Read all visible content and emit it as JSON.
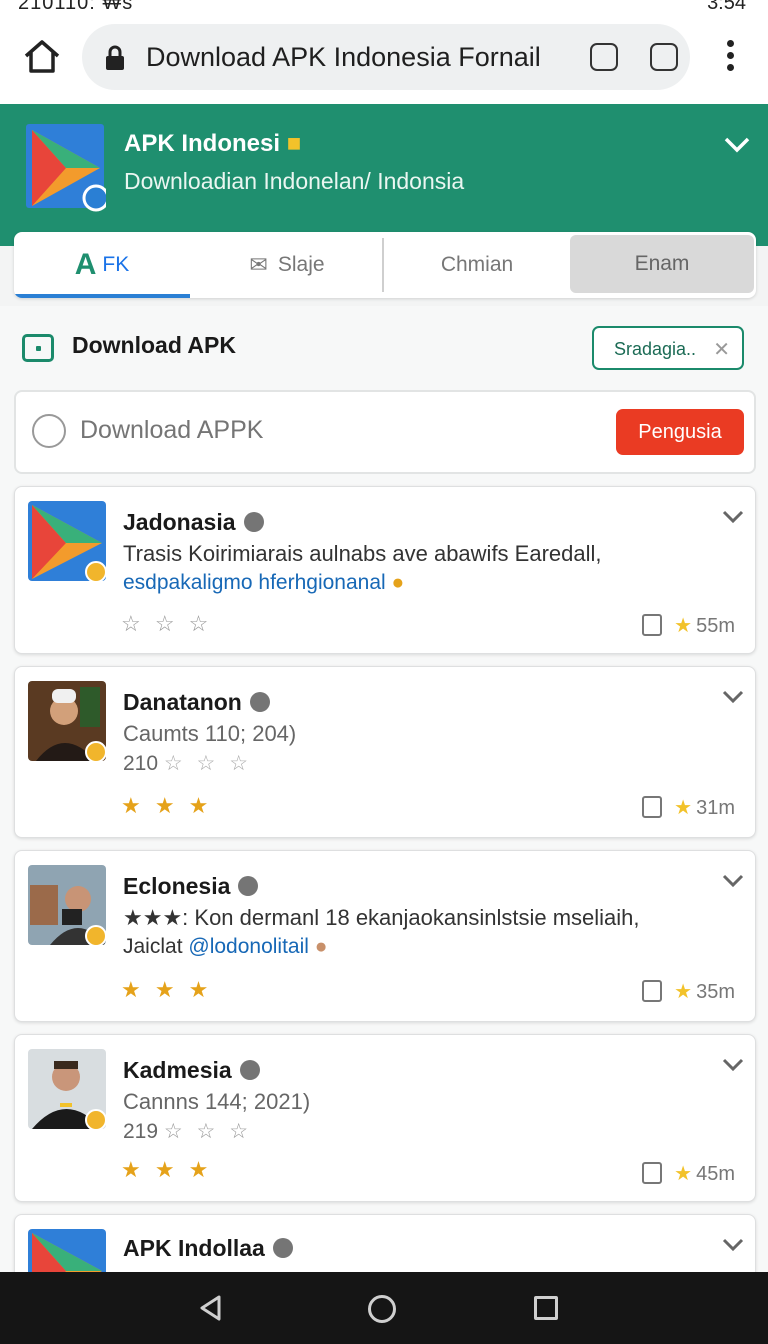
{
  "status_bar": {
    "left_text": "210110: ₩s",
    "right_text": "3:54"
  },
  "browser": {
    "url_text": "Download APK Indonesia Fornail"
  },
  "app_header": {
    "title": "APK Indonesi",
    "subtitle": "Downloadian Indonelan/ Indonsia"
  },
  "tabs": [
    {
      "label": "FK",
      "active": true
    },
    {
      "label": "Slaјe",
      "active": false
    },
    {
      "label": "Chmian",
      "active": false
    },
    {
      "label": "Enam",
      "active": false
    }
  ],
  "download_section": {
    "title": "Download APK",
    "filter_chip": "Sradagia..",
    "search_placeholder": "Download APPK",
    "search_button": "Pengusia"
  },
  "cards": [
    {
      "name": "Jadonasia",
      "line1": "Trasis Koirimiarais aulnabs ave abawifs Eаredall,",
      "line2": "esdpakaligmo hferhgionanal",
      "rating_stars": "☆ ☆ ☆",
      "time": "55m"
    },
    {
      "name": "Danatanon",
      "line1": "Caumts 110; 204)",
      "line2": "210",
      "line2_stars": "☆ ☆ ☆",
      "rating_stars": "★ ★ ★",
      "time": "31m"
    },
    {
      "name": "Eclonesia",
      "line1": "★★★: Kon dermanl 18 ekanjaokansinlstsie mseliaih,",
      "line2_prefix": "Jaiclat",
      "line2": "@lodonolitail",
      "rating_stars": "★ ★ ★",
      "time": "35m"
    },
    {
      "name": "Kadmesia",
      "line1": "Cannns 144; 2021)",
      "line2": "219",
      "line2_stars": "☆ ☆ ☆",
      "rating_stars": "★ ★ ★",
      "time": "45m"
    },
    {
      "name": "APK Indollaa",
      "line1": "",
      "line2": "",
      "rating_stars": "",
      "time": ""
    }
  ],
  "icons": [
    "home-icon",
    "lock-icon",
    "share-icon",
    "download-icon",
    "more-icon",
    "chevron-down-icon",
    "verified-icon",
    "thumb-icon",
    "star-icon",
    "back-icon",
    "home-nav-icon",
    "recents-icon"
  ],
  "colors": {
    "header_green": "#1f8f6f",
    "accent_blue": "#2a7fd4",
    "button_red": "#ea3b23",
    "star_gold": "#e5a21a"
  }
}
